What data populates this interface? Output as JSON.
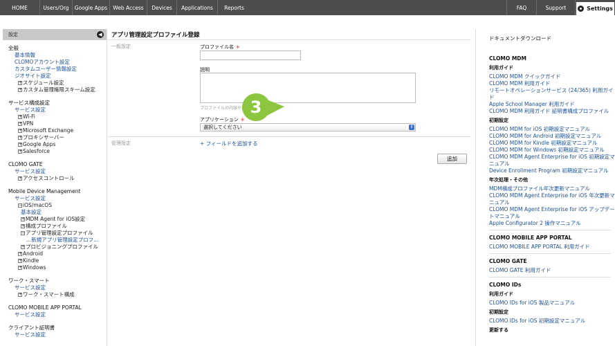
{
  "nav": {
    "items": [
      "HOME",
      "Users/Org",
      "Google Apps",
      "Web Access",
      "Devices",
      "Applications",
      "Reports"
    ],
    "right_items": [
      "FAQ",
      "Support"
    ],
    "settings_label": "Settings"
  },
  "sidebar": {
    "header": "設定",
    "groups": [
      {
        "title": "全般",
        "items": [
          {
            "label": "基本情報",
            "link": true,
            "level": 1,
            "box": ""
          },
          {
            "label": "CLOMOアカウント設定",
            "link": true,
            "level": 1,
            "box": ""
          },
          {
            "label": "カスタムユーザー情報設定",
            "link": true,
            "level": 1,
            "box": ""
          },
          {
            "label": "ジオサイト設定",
            "link": true,
            "level": 1,
            "box": ""
          },
          {
            "label": "スケジュール設定",
            "link": false,
            "level": 2,
            "box": "+"
          },
          {
            "label": "カスタム管理権限スキーム設定",
            "link": false,
            "level": 2,
            "box": "+"
          }
        ]
      },
      {
        "title": "サービス構成設定",
        "items": [
          {
            "label": "サービス設定",
            "link": true,
            "level": 1,
            "box": ""
          },
          {
            "label": "Wi-Fi",
            "link": false,
            "level": 2,
            "box": "+"
          },
          {
            "label": "VPN",
            "link": false,
            "level": 2,
            "box": "+"
          },
          {
            "label": "Microsoft Exchange",
            "link": false,
            "level": 2,
            "box": "+"
          },
          {
            "label": "プロキシサーバー",
            "link": false,
            "level": 2,
            "box": "+"
          },
          {
            "label": "Google Apps",
            "link": false,
            "level": 2,
            "box": "+"
          },
          {
            "label": "Salesforce",
            "link": false,
            "level": 2,
            "box": "+"
          }
        ]
      },
      {
        "title": "CLOMO GATE",
        "items": [
          {
            "label": "サービス設定",
            "link": true,
            "level": 1,
            "box": ""
          },
          {
            "label": "アクセスコントロール",
            "link": false,
            "level": 2,
            "box": "+"
          }
        ]
      },
      {
        "title": "Mobile Device Management",
        "items": [
          {
            "label": "サービス設定",
            "link": true,
            "level": 1,
            "box": ""
          },
          {
            "label": "iOS/macOS",
            "link": false,
            "level": 2,
            "box": "−"
          },
          {
            "label": "基本設定",
            "link": true,
            "level": 3,
            "box": ""
          },
          {
            "label": "MDM Agent for iOS設定",
            "link": false,
            "level": 3,
            "box": "+"
          },
          {
            "label": "構成プロファイル",
            "link": false,
            "level": 3,
            "box": "+"
          },
          {
            "label": "アプリ管理設定プロファイル",
            "link": false,
            "level": 3,
            "box": "−"
          },
          {
            "label": "...新規アプリ管理設定プロフ...",
            "link": true,
            "level": 4,
            "box": ""
          },
          {
            "label": "プロビジョニングプロファイル",
            "link": false,
            "level": 3,
            "box": "+"
          },
          {
            "label": "Android",
            "link": false,
            "level": 2,
            "box": "+"
          },
          {
            "label": "Kindle",
            "link": false,
            "level": 2,
            "box": "+"
          },
          {
            "label": "Windows",
            "link": false,
            "level": 2,
            "box": "+"
          }
        ]
      },
      {
        "title": "ワーク・スマート",
        "items": [
          {
            "label": "サービス設定",
            "link": true,
            "level": 1,
            "box": ""
          },
          {
            "label": "ワーク・スマート構成",
            "link": false,
            "level": 2,
            "box": "+"
          }
        ]
      },
      {
        "title": "CLOMO MOBILE APP PORTAL",
        "items": [
          {
            "label": "サービス設定",
            "link": true,
            "level": 1,
            "box": ""
          }
        ]
      },
      {
        "title": "クライアント証明書",
        "items": [
          {
            "label": "サービス設定",
            "link": true,
            "level": 1,
            "box": ""
          }
        ]
      }
    ]
  },
  "main": {
    "title": "アプリ管理設定プロファイル登録",
    "general_label": "一般設定",
    "profile_name_label": "プロファイル名",
    "description_label": "説明",
    "description_hint": "プロファイルの内容や目的の概要",
    "application_label": "アプリケーション",
    "required_mark": "＊",
    "select_value": "選択してください",
    "admin_label": "管理設定",
    "add_field_link": "+ フィールドを追加する",
    "add_button": "追加",
    "callout_number": "3",
    "callout_color": "#8cc63f"
  },
  "rightbar": {
    "title": "ドキュメントダウンロード",
    "sections": [
      {
        "heading": "CLOMO MDM",
        "groups": [
          {
            "sub": "利用ガイド",
            "links": [
              "CLOMO MDM クイックガイド",
              "CLOMO MDM 利用ガイド",
              "リモートオペレーションサービス (24/365) 利用ガイド",
              "Apple School Manager 利用ガイド",
              "CLOMO MDM 利用ガイド 証明書構成プロファイル"
            ]
          },
          {
            "sub": "初期設定",
            "links": [
              "CLOMO MDM for iOS 初期設定マニュアル",
              "CLOMO MDM for Android 初期設定マニュアル",
              "CLOMO MDM for Kindle 初期設定マニュアル",
              "CLOMO MDM for Windows 初期設定マニュアル",
              "CLOMO MDM Agent Enterprise for iOS 初期設定マニュアル",
              "Device Enrollment Program 初期設定マニュアル"
            ]
          },
          {
            "sub": "年次処理・その他",
            "links": [
              "MDM構成プロファイル年次更新マニュアル",
              "CLOMO MDM Agent Enterprise for iOS 年次更新マニュアル",
              "CLOMO MDM Agent Enterprise for iOS アップデートマニュアル",
              "Apple Configurator 2 操作マニュアル"
            ]
          }
        ]
      },
      {
        "heading": "CLOMO MOBILE APP PORTAL",
        "groups": [
          {
            "sub": "",
            "links": [
              "CLOMO MOBILE APP PORTAL 利用ガイド"
            ]
          }
        ]
      },
      {
        "heading": "CLOMO GATE",
        "groups": [
          {
            "sub": "",
            "links": [
              "CLOMO GATE 利用ガイド"
            ]
          }
        ]
      },
      {
        "heading": "CLOMO IDs",
        "groups": [
          {
            "sub": "利用ガイド",
            "links": [
              "CLOMO IDs for iOS 製品マニュアル"
            ]
          },
          {
            "sub": "初期設定",
            "links": [
              "CLOMO IDs for iOS 初期設定マニュアル"
            ]
          },
          {
            "sub": "更新する",
            "links": []
          }
        ]
      }
    ]
  }
}
